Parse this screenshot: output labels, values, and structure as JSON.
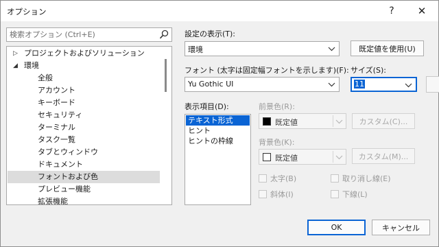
{
  "window": {
    "title": "オプション",
    "help_glyph": "?",
    "close_glyph": "✕"
  },
  "search": {
    "placeholder": "検索オプション (Ctrl+E)"
  },
  "tree": {
    "items": [
      {
        "label": "プロジェクトおよびソリューション",
        "expander": "▷",
        "expanded": false,
        "selected": false
      },
      {
        "label": "環境",
        "expander": "◢",
        "expanded": true,
        "selected": false
      },
      {
        "label": "全般",
        "selected": false
      },
      {
        "label": "アカウント",
        "selected": false
      },
      {
        "label": "キーボード",
        "selected": false
      },
      {
        "label": "セキュリティ",
        "selected": false
      },
      {
        "label": "ターミナル",
        "selected": false
      },
      {
        "label": "タスク一覧",
        "selected": false
      },
      {
        "label": "タブとウィンドウ",
        "selected": false
      },
      {
        "label": "ドキュメント",
        "selected": false
      },
      {
        "label": "フォントおよび色",
        "selected": true
      },
      {
        "label": "プレビュー機能",
        "selected": false
      },
      {
        "label": "拡張機能",
        "selected": false
      }
    ]
  },
  "settings": {
    "show_settings_for_label": "設定の表示(T):",
    "show_settings_for_value": "環境",
    "use_defaults_button": "既定値を使用(U)",
    "font_label": "フォント (太字は固定幅フォントを示します)(F):",
    "font_value": "Yu Gothic UI",
    "size_label": "サイズ(S):",
    "size_value": "11",
    "display_items_label": "表示項目(D):",
    "display_items": [
      "テキスト形式",
      "ヒント",
      "ヒントの枠線"
    ],
    "foreground_label": "前景色(R):",
    "foreground_value": "既定値",
    "foreground_swatch": "#000000",
    "foreground_custom_button": "カスタム(C)...",
    "background_label": "背景色(K):",
    "background_value": "既定値",
    "background_swatch": "#ffffff",
    "background_custom_button": "カスタム(M)...",
    "bold_label": "太字(B)",
    "strikethrough_label": "取り消し線(E)",
    "italic_label": "斜体(I)",
    "underline_label": "下線(L)"
  },
  "footer": {
    "ok_button": "OK",
    "cancel_button": "キャンセル"
  },
  "colors": {
    "accent": "#0a64d4",
    "dialog_bg": "#f0f0f0",
    "tree_selected": "#dcdcdc"
  }
}
